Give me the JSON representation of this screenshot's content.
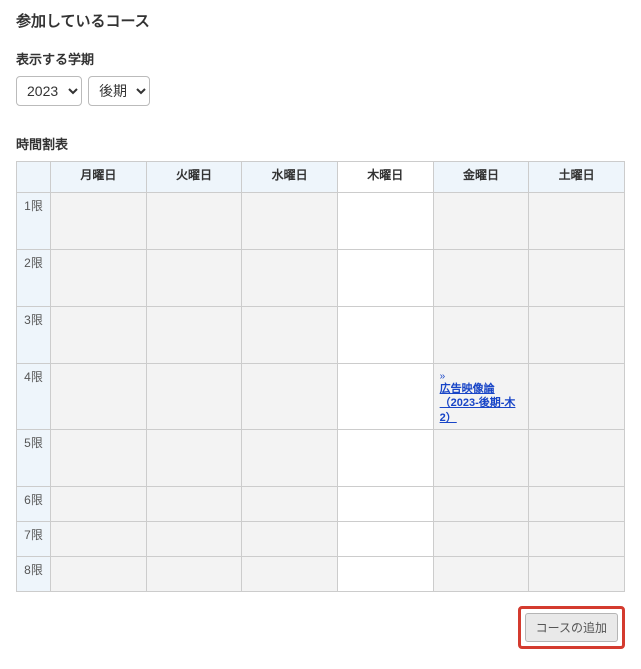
{
  "page_title": "参加しているコース",
  "term": {
    "label": "表示する学期",
    "year_value": "2023",
    "semester_value": "後期"
  },
  "timetable": {
    "label": "時間割表",
    "days": [
      "月曜日",
      "火曜日",
      "水曜日",
      "木曜日",
      "金曜日",
      "土曜日"
    ],
    "periods": [
      "1限",
      "2限",
      "3限",
      "4限",
      "5限",
      "6限",
      "7限",
      "8限"
    ],
    "today_index": 3,
    "entries": {
      "r3c4": {
        "text": "広告映像論（2023-後期-木2）"
      }
    }
  },
  "footer": {
    "add_course_label": "コースの追加"
  }
}
